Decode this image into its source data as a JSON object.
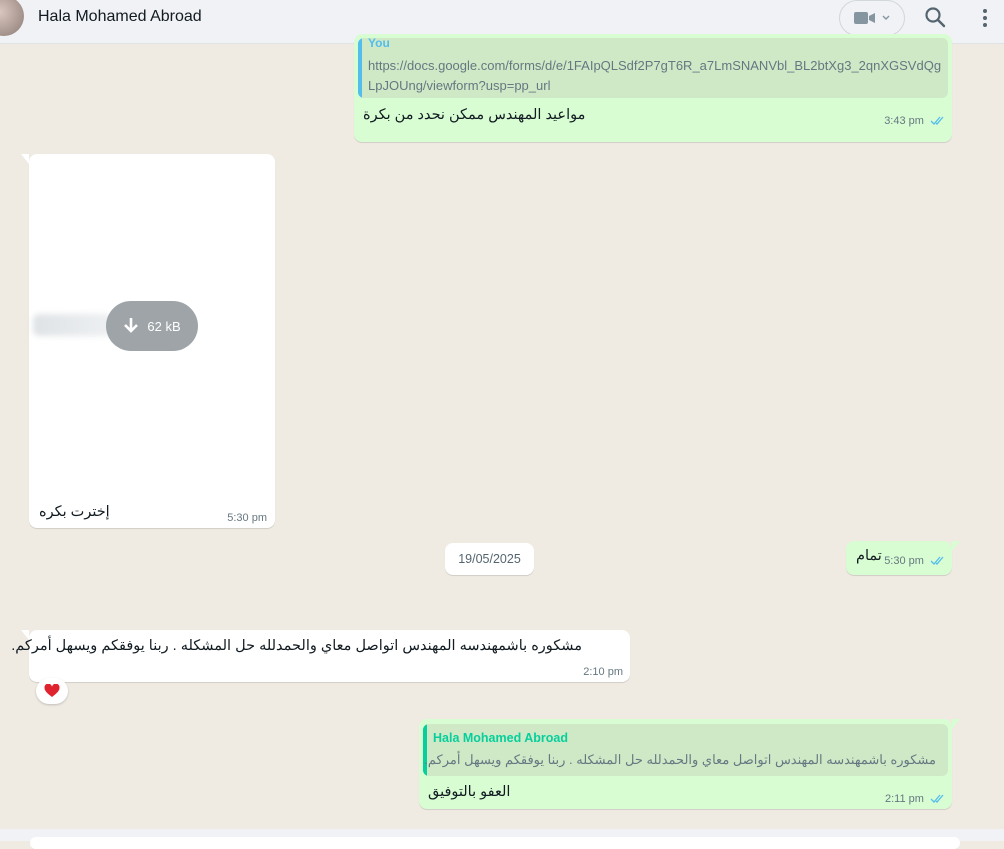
{
  "header": {
    "contact_name": "Hala Mohamed Abroad"
  },
  "messages": {
    "m1": {
      "quote_author": "You",
      "quote_line1": "https://docs.google.com/forms/d/e/1FAIpQLSdf2P7gT6R_a7LmSNANVbl_BL2btXg3_2qnXGSVdQg",
      "quote_line2": "LpJOUng/viewform?usp=pp_url",
      "text": "مواعيد المهندس ممكن نحدد من بكرة",
      "time": "3:43 pm"
    },
    "m2": {
      "file_size": "62 kB",
      "caption": "إخترت بكره",
      "time": "5:30 pm"
    },
    "m3": {
      "text": "تمام",
      "time": "5:30 pm"
    },
    "m4": {
      "text": "مشكوره باشمهندسه المهندس اتواصل معاي والحمدلله حل المشكله . ربنا يوفقكم ويسهل أمركم.",
      "time": "2:10 pm",
      "reaction": "❤️"
    },
    "m5": {
      "quote_author": "Hala Mohamed Abroad",
      "quote_text": "مشكوره باشمهندسه المهندس اتواصل معاي والحمدلله حل المشكله . ربنا يوفقكم ويسهل أمركم.",
      "text": "العفو بالتوفيق",
      "time": "2:11 pm"
    }
  },
  "date_divider": "19/05/2025",
  "colors": {
    "outgoing_bubble": "#d9fdd3",
    "incoming_bubble": "#ffffff",
    "read_ticks": "#53bdeb",
    "quote_author_contact": "#06cf9c",
    "quote_author_you": "#53bdeb",
    "chat_background": "#efeae2"
  },
  "icons": {
    "video": "video-camera-icon",
    "search": "search-icon",
    "menu": "kebab-menu-icon",
    "download": "download-arrow-icon",
    "ticks": "double-check-icon"
  }
}
